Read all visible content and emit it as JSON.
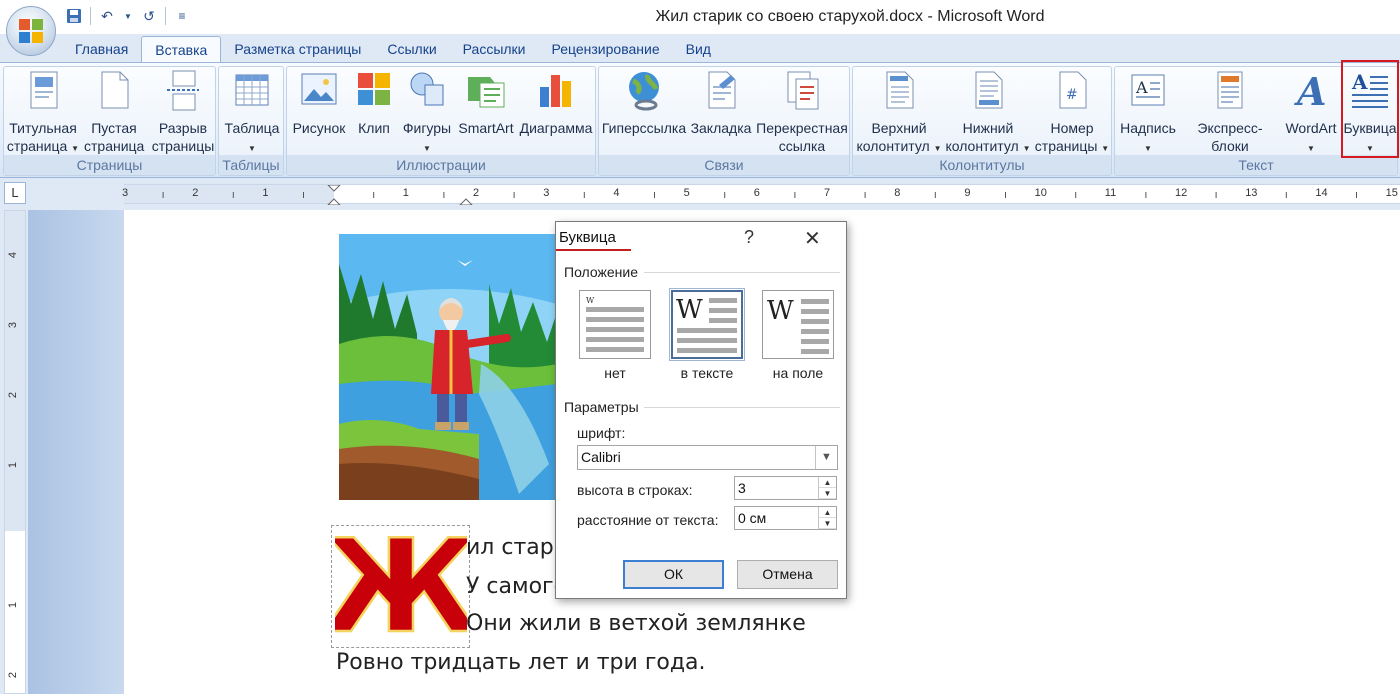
{
  "window": {
    "title": "Жил старик со своею старухой.docx - Microsoft Word"
  },
  "tabs": [
    "Главная",
    "Вставка",
    "Разметка страницы",
    "Ссылки",
    "Рассылки",
    "Рецензирование",
    "Вид"
  ],
  "active_tab": "Вставка",
  "ribbon": {
    "groups": {
      "pages": "Страницы",
      "tables": "Таблицы",
      "illustrations": "Иллюстрации",
      "links": "Связи",
      "headers": "Колонтитулы",
      "text": "Текст"
    },
    "buttons": {
      "cover_1": "Титульная",
      "cover_2": "страница",
      "blank_1": "Пустая",
      "blank_2": "страница",
      "break_1": "Разрыв",
      "break_2": "страницы",
      "table_1": "Таблица",
      "picture": "Рисунок",
      "clip": "Клип",
      "shapes": "Фигуры",
      "smartart": "SmartArt",
      "chart": "Диаграмма",
      "hyperlink": "Гиперссылка",
      "bookmark": "Закладка",
      "cross_1": "Перекрестная",
      "cross_2": "ссылка",
      "header_1": "Верхний",
      "header_2": "колонтитул",
      "footer_1": "Нижний",
      "footer_2": "колонтитул",
      "pagenum_1": "Номер",
      "pagenum_2": "страницы",
      "textbox": "Надпись",
      "quickparts": "Экспресс-блоки",
      "wordart": "WordArt",
      "dropcap": "Буквица"
    }
  },
  "ruler": {
    "tab_symbol": "L",
    "h_labels": [
      "3",
      "2",
      "1",
      "",
      "1",
      "2",
      "3",
      "4",
      "5",
      "6",
      "7",
      "8",
      "9",
      "10",
      "11",
      "12",
      "13",
      "14",
      "15"
    ],
    "v_labels": [
      "4",
      "3",
      "2",
      "1",
      "1",
      "2"
    ]
  },
  "document": {
    "dropcap_letter": "Ж",
    "line1": "ил стари",
    "line2": "У самого",
    "line3": "Они жили в ветхой землянке",
    "line4": "Ровно тридцать лет и три года."
  },
  "dialog": {
    "title": "Буквица",
    "help": "?",
    "close": "✕",
    "position_label": "Положение",
    "options": [
      "нет",
      "в тексте",
      "на поле"
    ],
    "selected_option": "в тексте",
    "params_label": "Параметры",
    "font_label": "шрифт:",
    "font_value": "Calibri",
    "lines_label": "высота в строках:",
    "lines_value": "3",
    "distance_label": "расстояние от текста:",
    "distance_value": "0 см",
    "ok": "ОК",
    "cancel": "Отмена"
  },
  "colors": {
    "dropcap_red": "#c8000a",
    "selection_border": "#d71920",
    "ribbon_text": "#15428b"
  }
}
